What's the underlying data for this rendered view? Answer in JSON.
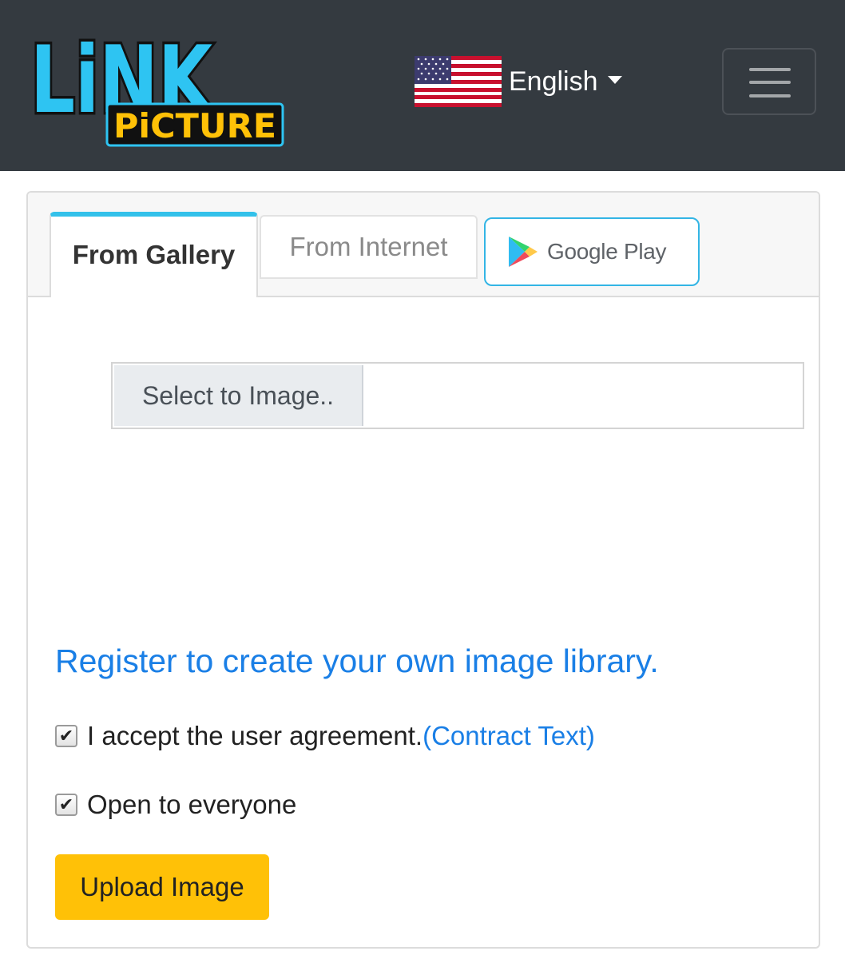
{
  "header": {
    "logo": {
      "line1": "LiNK",
      "line2": "PiCTURE",
      "colors": {
        "primary": "#2ec4f2",
        "secondary": "#ffc107",
        "outline": "#111111"
      }
    },
    "language": {
      "selected": "English",
      "flag_icon": "us-flag-icon"
    },
    "menu_icon": "hamburger-menu-icon",
    "background": "#343a40"
  },
  "tabs": {
    "gallery_label": "From Gallery",
    "internet_label": "From Internet",
    "active": "From Gallery",
    "active_accent": "#33c1ea"
  },
  "google_play": {
    "label": "Google Play",
    "icon": "google-play-icon"
  },
  "file_input": {
    "button_label": "Select to Image..",
    "value": ""
  },
  "register_link": "Register to create your own image library.",
  "agreement": {
    "label": "I accept the user agreement.",
    "link": "(Contract Text)",
    "checked": true
  },
  "open_everyone": {
    "label": "Open to everyone",
    "checked": true
  },
  "upload_button": "Upload Image",
  "colors": {
    "link": "#1a7fe6",
    "upload": "#ffc107"
  }
}
